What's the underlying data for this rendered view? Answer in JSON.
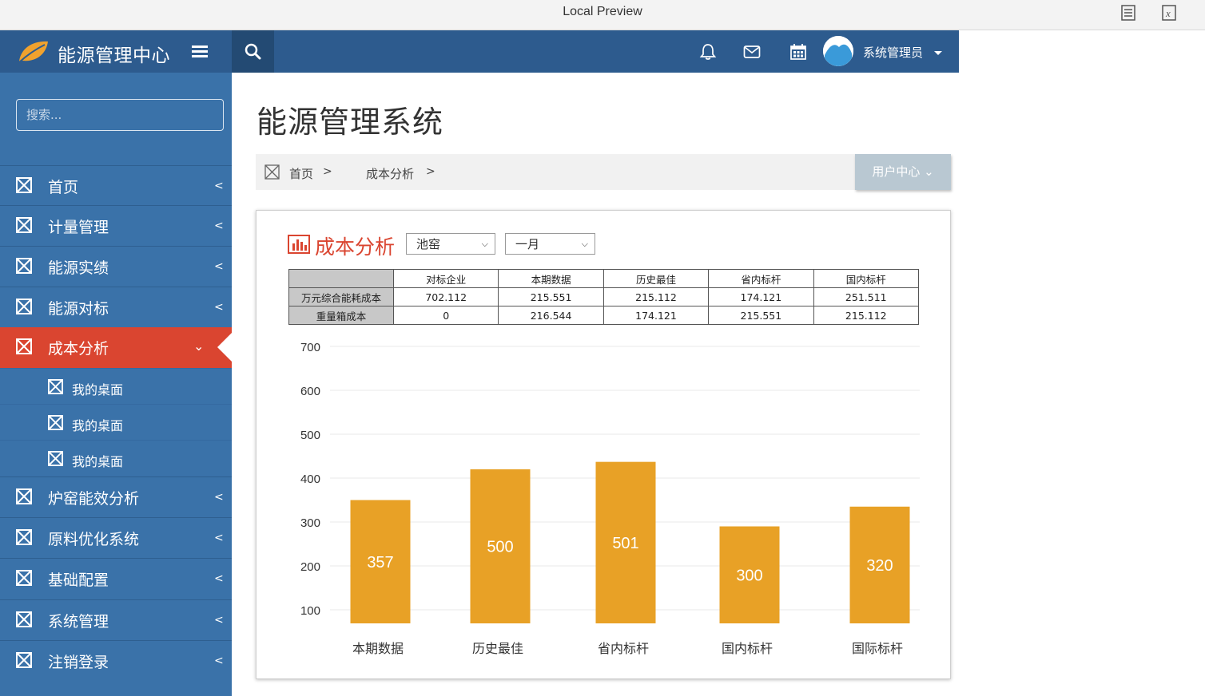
{
  "window": {
    "title": "Local Preview"
  },
  "header": {
    "brand": "能源管理中心",
    "user_name": "系统管理员"
  },
  "sidebar": {
    "search_placeholder": "搜索...",
    "items": [
      {
        "label": "首页"
      },
      {
        "label": "计量管理"
      },
      {
        "label": "能源实绩"
      },
      {
        "label": "能源对标"
      },
      {
        "label": "成本分析",
        "active": true
      },
      {
        "label": "炉窑能效分析"
      },
      {
        "label": "原料优化系统"
      },
      {
        "label": "基础配置"
      },
      {
        "label": "系统管理"
      },
      {
        "label": "注销登录"
      }
    ],
    "sub_items": [
      {
        "label": "我的桌面"
      },
      {
        "label": "我的桌面"
      },
      {
        "label": "我的桌面"
      }
    ]
  },
  "main": {
    "page_title": "能源管理系统",
    "breadcrumb": {
      "home": "首页",
      "current": "成本分析",
      "separator": ">"
    },
    "user_center": "用户中心"
  },
  "panel": {
    "title": "成本分析",
    "select1": "池窑",
    "select2": "一月",
    "table": {
      "headers": [
        "对标企业",
        "本期数据",
        "历史最佳",
        "省内标杆",
        "国内标杆"
      ],
      "rows": [
        {
          "label": "万元综合能耗成本",
          "values": [
            "702.112",
            "215.551",
            "215.112",
            "174.121",
            "251.511"
          ]
        },
        {
          "label": "重量箱成本",
          "values": [
            "0",
            "216.544",
            "174.121",
            "215.551",
            "215.112"
          ]
        }
      ]
    }
  },
  "colors": {
    "accent": "#da4530",
    "brand": "#2d5b8e",
    "sidebar": "#3a72a9",
    "bar": "#e8a126"
  },
  "chart_data": {
    "type": "bar",
    "categories": [
      "本期数据",
      "历史最佳",
      "省内标杆",
      "国内标杆",
      "国际标杆"
    ],
    "values": [
      357,
      500,
      501,
      300,
      320
    ],
    "bar_tops": [
      350,
      420,
      437,
      290,
      335
    ],
    "title": "",
    "xlabel": "",
    "ylabel": "",
    "yticks": [
      100,
      200,
      300,
      400,
      500,
      600,
      700
    ],
    "ylim": [
      0,
      700
    ],
    "grid": true,
    "legend": "none"
  }
}
